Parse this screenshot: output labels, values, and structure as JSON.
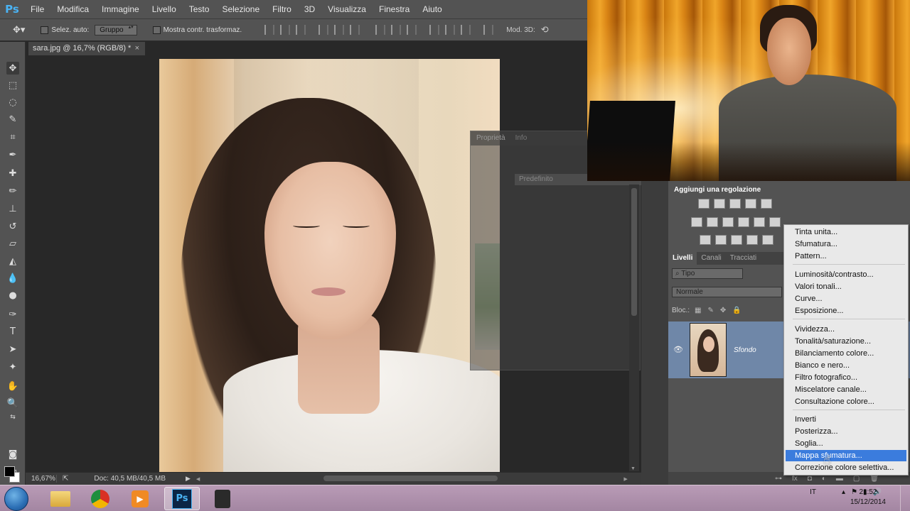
{
  "app": {
    "logo": "Ps"
  },
  "menu": [
    "File",
    "Modifica",
    "Immagine",
    "Livello",
    "Testo",
    "Selezione",
    "Filtro",
    "3D",
    "Visualizza",
    "Finestra",
    "Aiuto"
  ],
  "options": {
    "auto_select_label": "Selez. auto:",
    "auto_select_value": "Gruppo",
    "show_transform_label": "Mostra contr. trasformaz.",
    "mode3d_label": "Mod. 3D:"
  },
  "document": {
    "tab_title": "sara.jpg @ 16,7% (RGB/8) *",
    "close": "×"
  },
  "status": {
    "zoom": "16,67%",
    "doc_size": "Doc: 40,5 MB/40,5 MB"
  },
  "properties_panel": {
    "tabs": [
      "Proprietà",
      "Info"
    ],
    "preset": "Predefinito"
  },
  "adjustments": {
    "title": "Aggiungi una regolazione"
  },
  "layers": {
    "tabs": [
      "Livelli",
      "Canali",
      "Tracciati"
    ],
    "filter_type": "Tipo",
    "blend_mode": "Normale",
    "lock_label": "Bloc.:",
    "layer_name": "Sfondo"
  },
  "dropdown": {
    "items": [
      "Tinta unita...",
      "Sfumatura...",
      "Pattern...",
      "Luminosità/contrasto...",
      "Valori tonali...",
      "Curve...",
      "Esposizione...",
      "Vividezza...",
      "Tonalità/saturazione...",
      "Bilanciamento colore...",
      "Bianco e nero...",
      "Filtro fotografico...",
      "Miscelatore canale...",
      "Consultazione colore...",
      "Inverti",
      "Posterizza...",
      "Soglia...",
      "Mappa sfumatura...",
      "Correzione colore selettiva..."
    ],
    "highlighted": "Mappa sfumatura..."
  },
  "taskbar": {
    "apps": [
      "windows-explorer",
      "chrome",
      "media-player",
      "photoshop",
      "unknown-app"
    ],
    "active_app": "photoshop",
    "language": "IT",
    "time": "21:52",
    "date": "15/12/2014"
  }
}
